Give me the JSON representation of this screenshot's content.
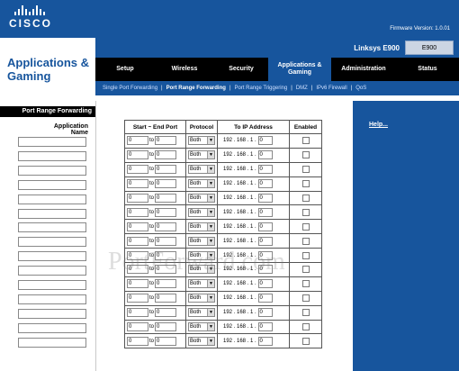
{
  "header": {
    "brand": "CISCO",
    "firmware": "Firmware Version: 1.0.01",
    "section_title": "Applications & Gaming",
    "model_name": "Linksys E900",
    "model_short": "E900"
  },
  "nav": {
    "tabs": [
      {
        "label": "Setup"
      },
      {
        "label": "Wireless"
      },
      {
        "label": "Security"
      },
      {
        "label": "Applications & Gaming"
      },
      {
        "label": "Administration"
      },
      {
        "label": "Status"
      }
    ],
    "subtabs": [
      {
        "label": "Single Port Forwarding"
      },
      {
        "label": "Port Range Forwarding"
      },
      {
        "label": "Port Range Triggering"
      },
      {
        "label": "DMZ"
      },
      {
        "label": "IPv6 Firewall"
      },
      {
        "label": "QoS"
      }
    ],
    "separator": "|"
  },
  "left": {
    "header": "Port Range Forwarding",
    "app_name_label": "Application Name"
  },
  "table": {
    "headers": {
      "port": "Start ~ End Port",
      "protocol": "Protocol",
      "ip": "To IP Address",
      "enabled": "Enabled"
    },
    "to_label": "to",
    "ip_prefix": "192 . 168 . 1 .",
    "rows": [
      {
        "start": "0",
        "end": "0",
        "protocol": "Both",
        "ip_last": "0"
      },
      {
        "start": "0",
        "end": "0",
        "protocol": "Both",
        "ip_last": "0"
      },
      {
        "start": "0",
        "end": "0",
        "protocol": "Both",
        "ip_last": "0"
      },
      {
        "start": "0",
        "end": "0",
        "protocol": "Both",
        "ip_last": "0"
      },
      {
        "start": "0",
        "end": "0",
        "protocol": "Both",
        "ip_last": "0"
      },
      {
        "start": "0",
        "end": "0",
        "protocol": "Both",
        "ip_last": "0"
      },
      {
        "start": "0",
        "end": "0",
        "protocol": "Both",
        "ip_last": "0"
      },
      {
        "start": "0",
        "end": "0",
        "protocol": "Both",
        "ip_last": "0"
      },
      {
        "start": "0",
        "end": "0",
        "protocol": "Both",
        "ip_last": "0"
      },
      {
        "start": "0",
        "end": "0",
        "protocol": "Both",
        "ip_last": "0"
      },
      {
        "start": "0",
        "end": "0",
        "protocol": "Both",
        "ip_last": "0"
      },
      {
        "start": "0",
        "end": "0",
        "protocol": "Both",
        "ip_last": "0"
      },
      {
        "start": "0",
        "end": "0",
        "protocol": "Both",
        "ip_last": "0"
      },
      {
        "start": "0",
        "end": "0",
        "protocol": "Both",
        "ip_last": "0"
      },
      {
        "start": "0",
        "end": "0",
        "protocol": "Both",
        "ip_last": "0"
      }
    ]
  },
  "help": {
    "label": "Help..."
  },
  "watermark": "PortForward.com",
  "colors": {
    "brand_blue": "#17559d",
    "nav_black": "#000000"
  }
}
